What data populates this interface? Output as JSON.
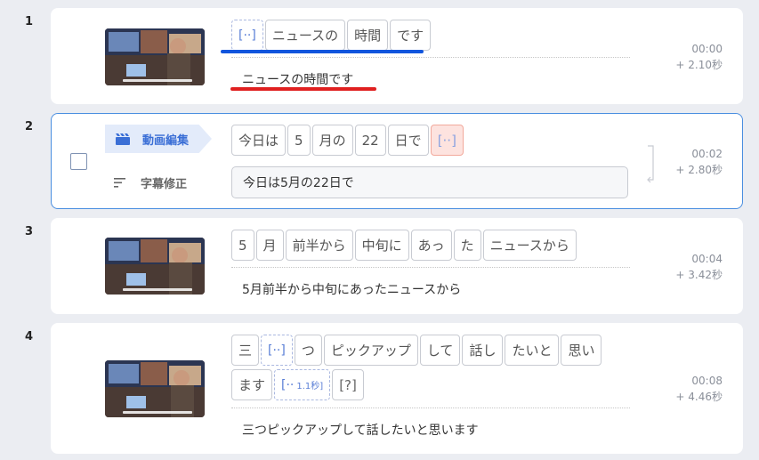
{
  "rows": [
    {
      "num": "1",
      "chips": [
        "[··]",
        "ニュースの",
        "時間",
        "です"
      ],
      "subtitle": "ニュースの時間です",
      "time": "00:00",
      "duration": "+ 2.10秒"
    },
    {
      "num": "2",
      "edit_label": "動画編集",
      "fix_label": "字幕修正",
      "chips": [
        "今日は",
        "5",
        "月の",
        "22",
        "日で",
        "[··]"
      ],
      "subtitle": "今日は5月の22日で",
      "time": "00:02",
      "duration": "+ 2.80秒"
    },
    {
      "num": "3",
      "chips": [
        "5",
        "月",
        "前半から",
        "中旬に",
        "あっ",
        "た",
        "ニュースから"
      ],
      "subtitle": "5月前半から中旬にあったニュースから",
      "time": "00:04",
      "duration": "+ 3.42秒"
    },
    {
      "num": "4",
      "chips": [
        "三",
        "[··]",
        "つ",
        "ピックアップ",
        "して",
        "話し",
        "たいと",
        "思い",
        "ます"
      ],
      "chip_gap_label": "[··",
      "chip_gap_dur": "1.1秒]",
      "chip_unknown": "[?]",
      "subtitle": "三つピックアップして話したいと思います",
      "time": "00:08",
      "duration": "+ 4.46秒"
    }
  ],
  "colors": {
    "accent_blue": "#1155dd",
    "accent_red": "#e02020",
    "active_border": "#4a8ee0"
  }
}
